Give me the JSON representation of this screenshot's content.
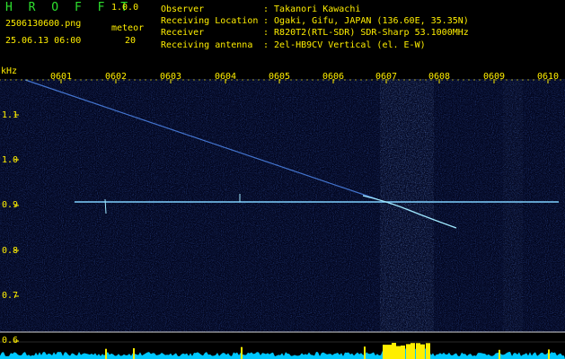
{
  "app": {
    "title": "H R O F F T",
    "version": "1.0.0"
  },
  "file": {
    "name": "2506130600.png",
    "timestamp": "25.06.13 06:00"
  },
  "meteor": {
    "label": "meteor",
    "count": "20"
  },
  "info": [
    {
      "key": "Observer",
      "value": ": Takanori Kawachi"
    },
    {
      "key": "Receiving Location",
      "value": ": Ogaki, Gifu, JAPAN (136.60E, 35.35N)"
    },
    {
      "key": "Receiver",
      "value": ": R820T2(RTL-SDR) SDR-Sharp 53.1000MHz"
    },
    {
      "key": "Receiving antenna",
      "value": ": 2el-HB9CV Vertical (el. E-W)"
    }
  ],
  "axis": {
    "unit": "kHz",
    "minutes": [
      "0601",
      "0602",
      "0603",
      "0604",
      "0605",
      "0606",
      "0607",
      "0608",
      "0609",
      "0610"
    ],
    "freq_labels": [
      "1.1",
      "1.0",
      "0.9",
      "0.8",
      "0.7",
      "0.6"
    ]
  },
  "colors": {
    "text": "#ffee00",
    "title": "#2ee02e",
    "background": "#02061f",
    "trace": "#7fd0ff",
    "power": "#00c8ff",
    "peak": "#ffee00"
  }
}
